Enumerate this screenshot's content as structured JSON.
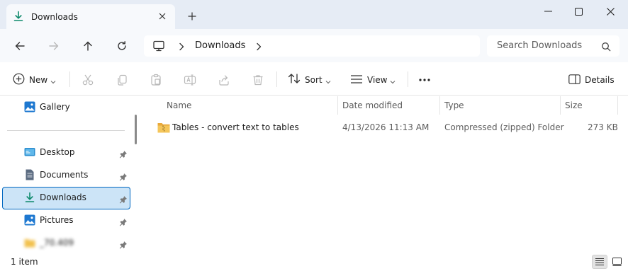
{
  "window": {
    "tab_title": "Downloads",
    "icons": {
      "tab": "download-arrow-icon",
      "close_tab": "close-icon",
      "new_tab": "plus-icon",
      "minimize": "minimize-icon",
      "maximize": "maximize-icon",
      "close": "close-icon"
    }
  },
  "nav": {
    "icons": [
      "back-arrow-icon",
      "forward-arrow-icon",
      "up-arrow-icon",
      "refresh-icon"
    ],
    "breadcrumb": {
      "root_icon": "monitor-icon",
      "items": [
        "Downloads"
      ]
    },
    "search": {
      "placeholder": "Search Downloads",
      "icon": "search-icon"
    }
  },
  "commands": {
    "new_label": "New",
    "sort_label": "Sort",
    "view_label": "View",
    "more_icon": "ellipsis-icon",
    "details_label": "Details",
    "disabled_icons": [
      "cut-icon",
      "copy-icon",
      "paste-icon",
      "rename-icon",
      "share-icon",
      "delete-icon"
    ]
  },
  "sidebar": {
    "items": [
      {
        "label": "Gallery",
        "icon": "gallery-icon",
        "pinned": false,
        "selected": false
      },
      {
        "label": "Desktop",
        "icon": "desktop-icon",
        "pinned": true,
        "selected": false
      },
      {
        "label": "Documents",
        "icon": "documents-icon",
        "pinned": true,
        "selected": false
      },
      {
        "label": "Downloads",
        "icon": "download-arrow-icon",
        "pinned": true,
        "selected": true
      },
      {
        "label": "Pictures",
        "icon": "pictures-icon",
        "pinned": true,
        "selected": false
      },
      {
        "label": "_70.409",
        "icon": "folder-icon",
        "pinned": true,
        "selected": false,
        "blurred": true
      }
    ]
  },
  "files": {
    "columns": [
      "Name",
      "Date modified",
      "Type",
      "Size"
    ],
    "rows": [
      {
        "name": "Tables - convert text to tables",
        "date": "4/13/2026 11:13 AM",
        "type": "Compressed (zipped) Folder",
        "size": "273 KB",
        "icon": "zip-folder-icon"
      }
    ]
  },
  "status": {
    "count": "1 item",
    "views": [
      "details-view-icon",
      "tiles-view-icon"
    ]
  },
  "colors": {
    "accent": "#0067c0",
    "selection_bg": "#cce4f7",
    "download_green": "#0f8a6c",
    "folder_yellow": "#f2c14e"
  }
}
